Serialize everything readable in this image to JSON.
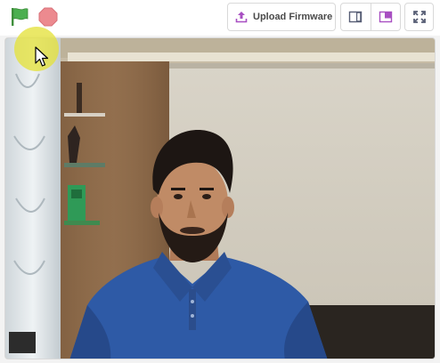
{
  "toolbar": {
    "green_flag_icon": "green-flag-icon",
    "stop_icon": "stop-icon",
    "upload_firmware_label": "Upload Firmware",
    "upload_icon": "upload-icon",
    "small_stage_icon": "small-stage-icon",
    "large_stage_icon": "large-stage-icon",
    "fullscreen_icon": "fullscreen-icon"
  },
  "colors": {
    "green_flag": "#4caf50",
    "stop": "#ec8a8f",
    "accent": "#a84fc2",
    "icon_dark": "#575e75",
    "cursor_highlight": "#e4e23c"
  },
  "stage": {
    "content": "webcam-video-feed"
  }
}
